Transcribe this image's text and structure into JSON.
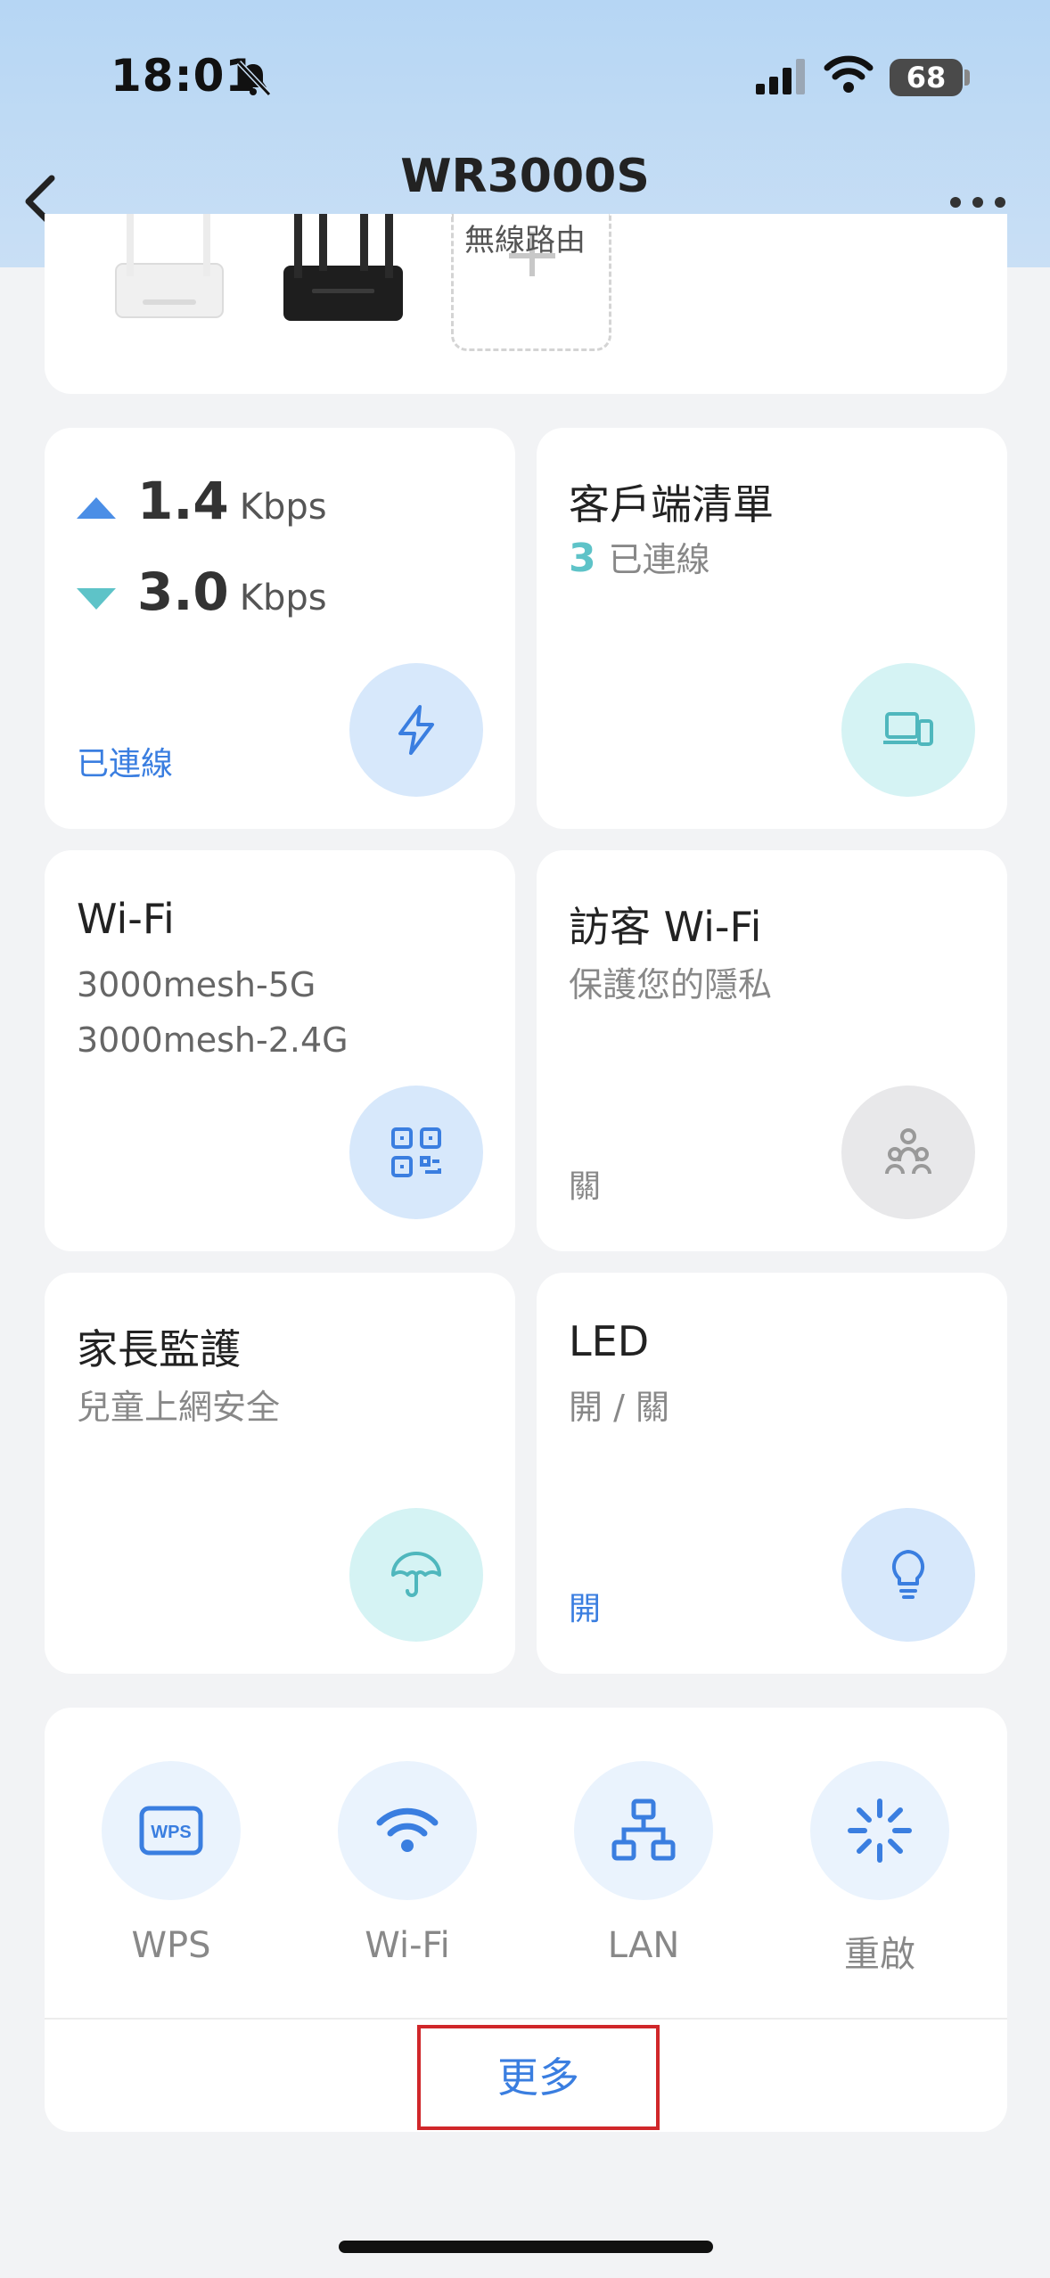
{
  "status_bar": {
    "time": "18:01",
    "battery": "68"
  },
  "nav": {
    "title": "WR3000S",
    "subtitle": "無線路由"
  },
  "speed_tile": {
    "upload_value": "1.4",
    "upload_unit": "Kbps",
    "download_value": "3.0",
    "download_unit": "Kbps",
    "status": "已連線",
    "icon": "lightning-icon"
  },
  "clients_tile": {
    "title": "客戶端清單",
    "count": "3",
    "count_label": "已連線",
    "icon": "devices-icon"
  },
  "wifi_tile": {
    "title": "Wi-Fi",
    "ssid_5g": "3000mesh-5G",
    "ssid_24g": "3000mesh-2.4G",
    "icon": "qr-code-icon"
  },
  "guest_tile": {
    "title": "訪客 Wi-Fi",
    "subtitle": "保護您的隱私",
    "status": "關",
    "icon": "guest-icon"
  },
  "parental_tile": {
    "title": "家長監護",
    "subtitle": "兒童上網安全",
    "icon": "umbrella-icon"
  },
  "led_tile": {
    "title": "LED",
    "subtitle": "開 / 關",
    "status": "開",
    "icon": "bulb-icon"
  },
  "actions": [
    {
      "label": "WPS",
      "icon": "wps-icon"
    },
    {
      "label": "Wi-Fi",
      "icon": "wifi-icon"
    },
    {
      "label": "LAN",
      "icon": "lan-icon"
    },
    {
      "label": "重啟",
      "icon": "restart-icon"
    }
  ],
  "more_label": "更多",
  "colors": {
    "accent": "#3a7ee0",
    "cyan": "#5ec3c8",
    "highlight": "#d0272a"
  }
}
